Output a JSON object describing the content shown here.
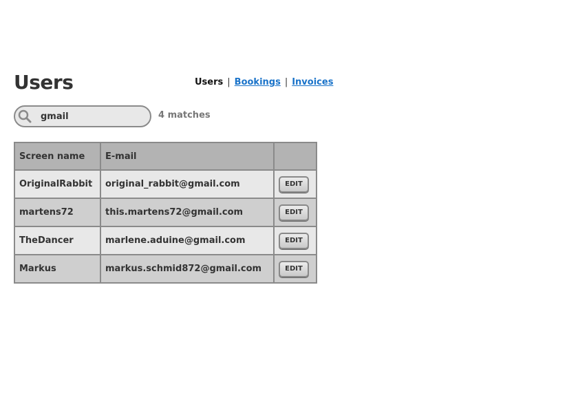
{
  "page": {
    "title": "Users"
  },
  "nav": {
    "current": "Users",
    "separator": "|",
    "links": [
      "Bookings",
      "Invoices"
    ]
  },
  "search": {
    "value": "gmail",
    "icon": "search-icon",
    "match_count": "4 matches"
  },
  "table": {
    "headers": [
      "Screen name",
      "E-mail",
      ""
    ],
    "rows": [
      {
        "screen_name": "OriginalRabbit",
        "email": "original_rabbit@gmail.com",
        "action": "EDIT"
      },
      {
        "screen_name": "martens72",
        "email": "this.martens72@gmail.com",
        "action": "EDIT"
      },
      {
        "screen_name": "TheDancer",
        "email": "marlene.aduine@gmail.com",
        "action": "EDIT"
      },
      {
        "screen_name": "Markus",
        "email": "markus.schmid872@gmail.com",
        "action": "EDIT"
      }
    ]
  },
  "colors": {
    "link": "#1a73c9",
    "header_bg": "#b3b3b3",
    "row_light": "#e8e8e8",
    "row_dark": "#cfcfcf",
    "border": "#8a8a8a"
  }
}
